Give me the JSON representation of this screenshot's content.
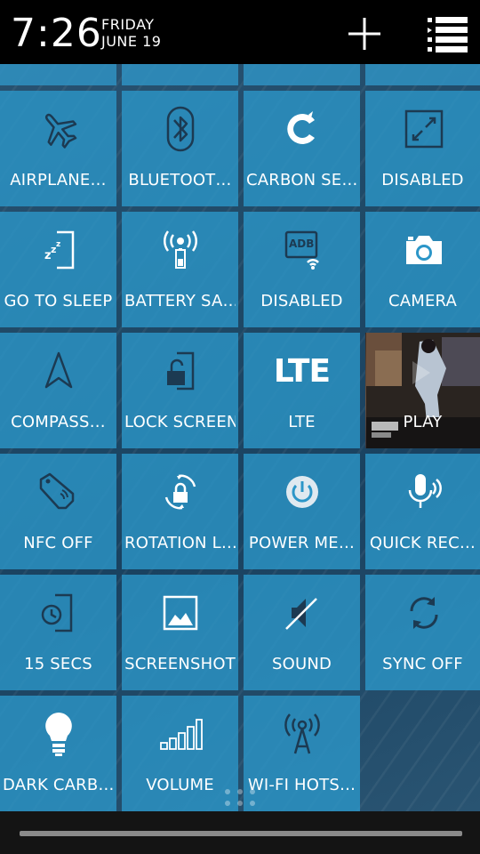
{
  "status_bar": {
    "time": "7:26",
    "day": "FRIDAY",
    "date": "JUNE 19",
    "add_icon": "plus-icon",
    "list_icon": "list-icon"
  },
  "tiles": [
    {
      "label": "AIRPLANE…",
      "icon": "airplane-icon"
    },
    {
      "label": "BLUETOOT…",
      "icon": "bluetooth-icon"
    },
    {
      "label": "CARBON SE…",
      "icon": "carbon-icon"
    },
    {
      "label": "DISABLED",
      "icon": "expand-icon"
    },
    {
      "label": "GO TO SLEEP",
      "icon": "sleep-icon"
    },
    {
      "label": "BATTERY SA…",
      "icon": "battery-saver-icon"
    },
    {
      "label": "DISABLED",
      "icon": "adb-icon",
      "badge": "ADB"
    },
    {
      "label": "CAMERA",
      "icon": "camera-icon"
    },
    {
      "label": "COMPASS…",
      "icon": "compass-icon"
    },
    {
      "label": "LOCK SCREEN",
      "icon": "lock-screen-icon"
    },
    {
      "label": "LTE",
      "icon": "lte-icon",
      "icon_text": "LTE"
    },
    {
      "label": "PLAY",
      "icon": "play-icon"
    },
    {
      "label": "NFC OFF",
      "icon": "nfc-icon"
    },
    {
      "label": "ROTATION L…",
      "icon": "rotation-lock-icon"
    },
    {
      "label": "POWER ME…",
      "icon": "power-icon"
    },
    {
      "label": "QUICK REC…",
      "icon": "microphone-icon"
    },
    {
      "label": "15 SECS",
      "icon": "screen-timeout-icon"
    },
    {
      "label": "SCREENSHOT",
      "icon": "screenshot-icon"
    },
    {
      "label": "SOUND",
      "icon": "sound-muted-icon"
    },
    {
      "label": "SYNC OFF",
      "icon": "sync-icon"
    },
    {
      "label": "DARK CARB…",
      "icon": "lightbulb-icon"
    },
    {
      "label": "VOLUME",
      "icon": "volume-bars-icon"
    },
    {
      "label": "WI-FI HOTS…",
      "icon": "wifi-hotspot-icon"
    }
  ],
  "colors": {
    "tile": "#2c96c8",
    "status_bar": "#000000",
    "bottom_bar": "#141414"
  }
}
